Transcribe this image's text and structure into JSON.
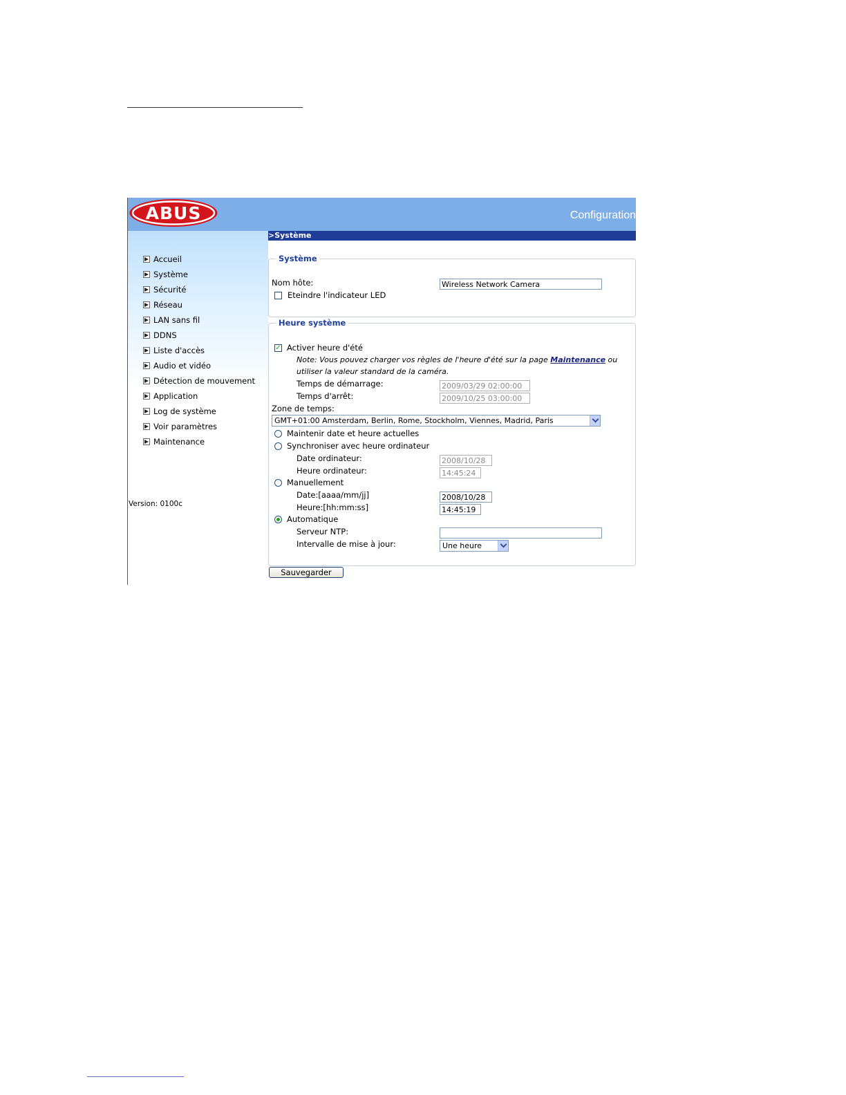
{
  "header": {
    "logo_text": "ABUS",
    "title": "Configuration"
  },
  "sidebar": {
    "items": [
      {
        "label": "Accueil"
      },
      {
        "label": "Système"
      },
      {
        "label": "Sécurité"
      },
      {
        "label": "Réseau"
      },
      {
        "label": "LAN sans fil"
      },
      {
        "label": "DDNS"
      },
      {
        "label": "Liste d'accès"
      },
      {
        "label": "Audio et vidéo"
      },
      {
        "label": "Détection de mouvement"
      },
      {
        "label": "Application"
      },
      {
        "label": "Log de système"
      },
      {
        "label": "Voir paramètres"
      },
      {
        "label": "Maintenance"
      }
    ],
    "version": "Version: 0100c"
  },
  "main": {
    "section_title": ">Système",
    "system_group": {
      "legend": "Système",
      "hostname_label": "Nom hôte:",
      "hostname_value": "Wireless Network Camera",
      "led_label": "Eteindre l'indicateur LED",
      "led_checked": false
    },
    "time_group": {
      "legend": "Heure système",
      "dst_label": "Activer heure d'été",
      "dst_checked": true,
      "note_line1_prefix": "Note: Vous pouvez charger vos règles de l'heure d'été sur la page ",
      "note_link": "Maintenance",
      "note_line1_suffix": " ou",
      "note_line2": "utiliser la valeur standard de la caméra.",
      "start_label": "Temps de démarrage:",
      "start_value": "2009/03/29 02:00:00",
      "stop_label": "Temps d'arrêt:",
      "stop_value": "2009/10/25 03:00:00",
      "timezone_label": "Zone de temps:",
      "timezone_value": "GMT+01:00 Amsterdam, Berlin, Rome, Stockholm, Viennes, Madrid, Paris",
      "keep_label": "Maintenir date et heure actuelles",
      "sync_label": "Synchroniser avec heure ordinateur",
      "pc_date_label": "Date ordinateur:",
      "pc_date_value": "2008/10/28",
      "pc_time_label": "Heure ordinateur:",
      "pc_time_value": "14:45:24",
      "manual_label": "Manuellement",
      "manual_date_label": "Date:[aaaa/mm/jj]",
      "manual_date_value": "2008/10/28",
      "manual_time_label": "Heure:[hh:mm:ss]",
      "manual_time_value": "14:45:19",
      "auto_label": "Automatique",
      "ntp_label": "Serveur NTP:",
      "ntp_value": "",
      "interval_label": "Intervalle de mise à jour:",
      "interval_value": "Une heure",
      "selected_mode": "Automatique"
    },
    "save_label": "Sauvegarder"
  },
  "colors": {
    "header_bg": "#7eaee8",
    "section_bar": "#1f3c96",
    "legend_text": "#1f3f9f",
    "logo_red": "#d4151b"
  }
}
